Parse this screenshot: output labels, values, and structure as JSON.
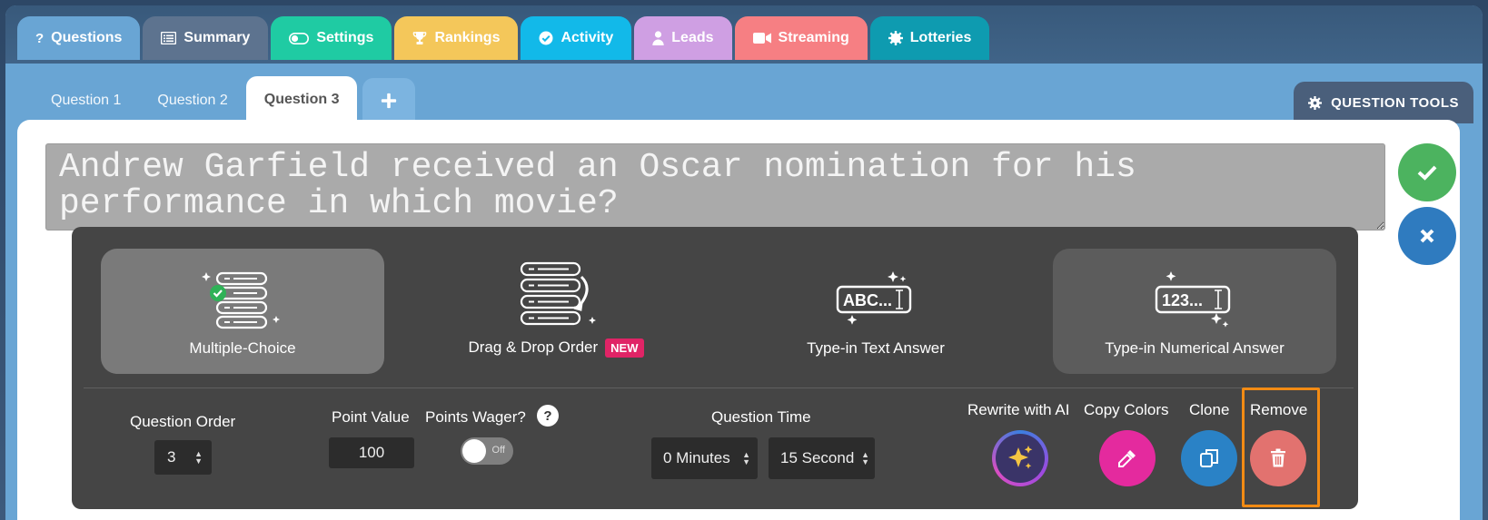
{
  "main_tabs": [
    {
      "label": "Questions",
      "icon": "question-icon",
      "color": "#69a5d4"
    },
    {
      "label": "Summary",
      "icon": "list-icon",
      "color": "#5d738f"
    },
    {
      "label": "Settings",
      "icon": "toggle-icon",
      "color": "#1fcba3"
    },
    {
      "label": "Rankings",
      "icon": "trophy-icon",
      "color": "#f4c75a"
    },
    {
      "label": "Activity",
      "icon": "check-circle-icon",
      "color": "#12b9e9"
    },
    {
      "label": "Leads",
      "icon": "user-icon",
      "color": "#cf9fe3"
    },
    {
      "label": "Streaming",
      "icon": "video-icon",
      "color": "#f67f83"
    },
    {
      "label": "Lotteries",
      "icon": "gear-icon",
      "color": "#0e9bb0"
    }
  ],
  "question_tabs": {
    "items": [
      "Question 1",
      "Question 2",
      "Question 3"
    ],
    "active": "Question 3",
    "add_label": "+"
  },
  "question_tools": {
    "label": "QUESTION TOOLS"
  },
  "question_text": "Andrew Garfield received an Oscar nomination for his performance in which movie?",
  "actions": {
    "confirm_color": "#4cb35f",
    "cancel_color": "#2f7bbf"
  },
  "question_types": {
    "multiple_choice": "Multiple-Choice",
    "drag_drop": "Drag & Drop Order",
    "drag_drop_badge": "NEW",
    "text_answer": "Type-in Text Answer",
    "text_answer_glyph": "ABC...",
    "numerical_answer": "Type-in Numerical Answer",
    "numerical_answer_glyph": "123..."
  },
  "settings": {
    "question_order_label": "Question Order",
    "question_order_value": "3",
    "point_value_label": "Point Value",
    "point_value": "100",
    "points_wager_label": "Points Wager?",
    "points_wager_help": "?",
    "points_wager_state": "Off",
    "question_time_label": "Question Time",
    "minutes_value": "0 Minutes",
    "seconds_value": "15 Second"
  },
  "tools": {
    "rewrite_label": "Rewrite with AI",
    "copy_colors_label": "Copy Colors",
    "clone_label": "Clone",
    "remove_label": "Remove",
    "copy_colors_color": "#e42a9e",
    "clone_color": "#2a82c6",
    "remove_color": "#e2726f",
    "highlight_color": "#f28b14"
  }
}
